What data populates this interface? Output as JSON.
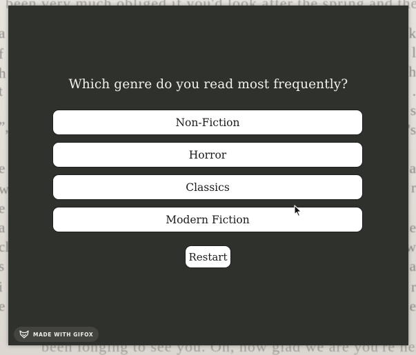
{
  "background": {
    "top_line": "been very much obliged if you'd look after the spring and then I'd the",
    "bottom_line": "been longing to see you.    Oh, how glad we are you're here !",
    "left_letters": [
      "a",
      "f",
      "h",
      "t",
      "”,",
      "e",
      "w",
      "e",
      "a",
      "cl",
      "s",
      "i",
      "e"
    ],
    "right_letters": [
      "k",
      "l",
      "h",
      ".",
      "s",
      "'s",
      "a",
      "r",
      "e",
      "w",
      "a",
      "r",
      "e"
    ]
  },
  "quiz": {
    "question": "Which genre do you read most frequently?",
    "options": [
      {
        "label": "Non-Fiction"
      },
      {
        "label": "Horror"
      },
      {
        "label": "Classics"
      },
      {
        "label": "Modern Fiction"
      }
    ],
    "restart_label": "Restart"
  },
  "badge": {
    "text": "MADE WITH GIFOX",
    "icon": "fox-icon"
  },
  "colors": {
    "panel_bg": "#2e312c",
    "button_bg": "#ffffff",
    "text_light": "#f3f1ec",
    "text_dark": "#1a1a1a"
  }
}
